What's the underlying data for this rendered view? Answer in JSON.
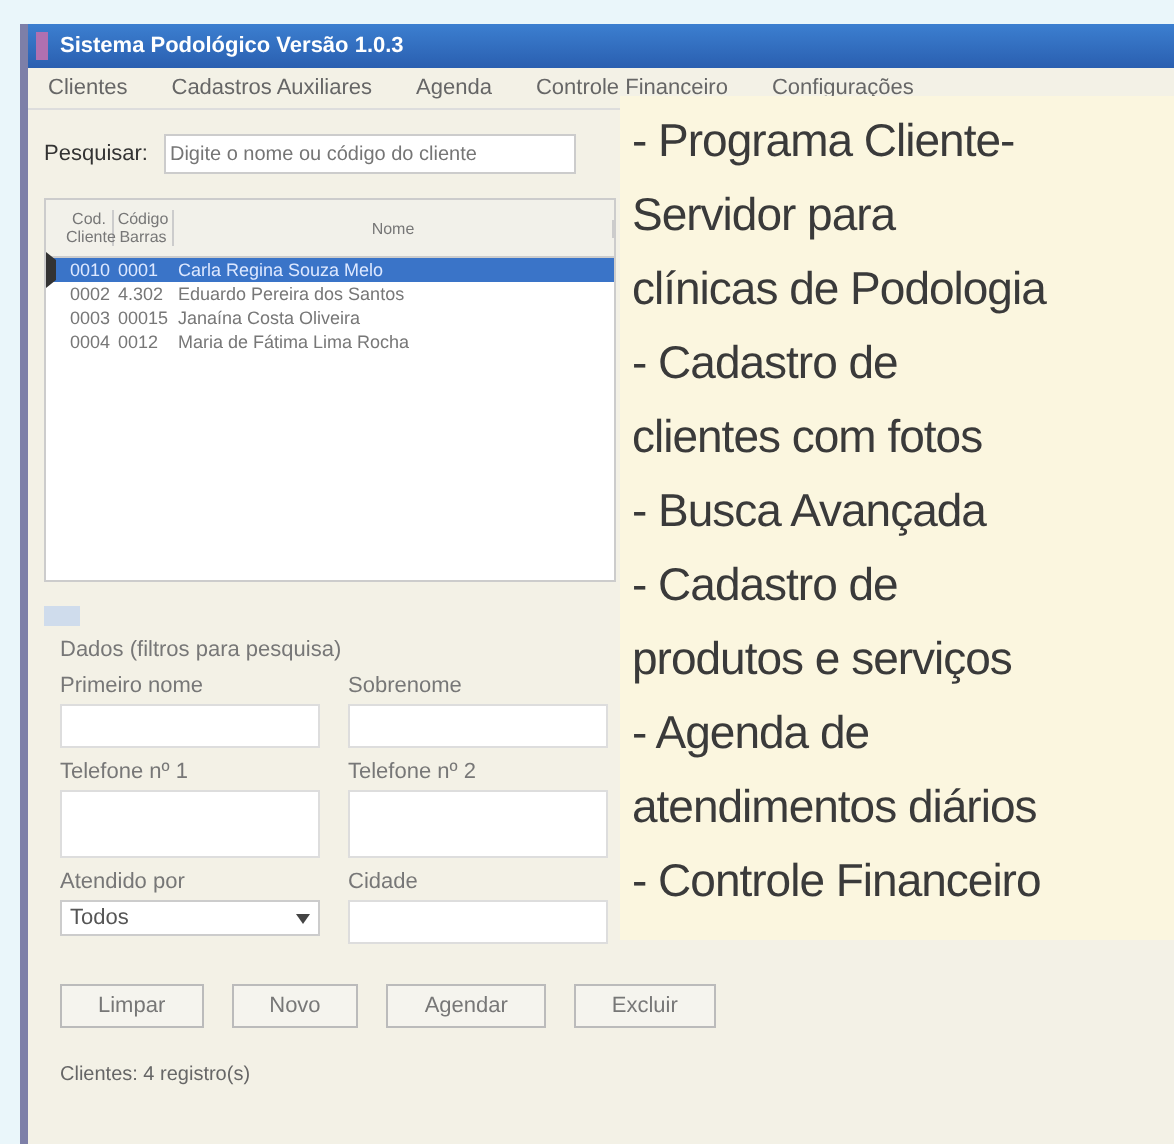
{
  "window": {
    "title": "Sistema Podológico Versão 1.0.3"
  },
  "menu": [
    "Clientes",
    "Cadastros Auxiliares",
    "Agenda",
    "Controle Financeiro",
    "Configurações"
  ],
  "search": {
    "label": "Pesquisar:",
    "placeholder": "Digite o nome ou código do cliente"
  },
  "table": {
    "columns": [
      "Cod. Cliente",
      "Código Barras",
      "Nome"
    ],
    "rows": [
      {
        "selected": true,
        "cells": [
          "0010",
          "0001",
          "Carla Regina Souza Melo"
        ]
      },
      {
        "selected": false,
        "cells": [
          "0002",
          "4.302",
          "Eduardo Pereira dos Santos"
        ]
      },
      {
        "selected": false,
        "cells": [
          "0003",
          "00015",
          "Janaína Costa Oliveira"
        ]
      },
      {
        "selected": false,
        "cells": [
          "0004",
          "0012",
          "Maria de Fátima Lima Rocha"
        ]
      }
    ]
  },
  "filters": {
    "expanded": true,
    "title": "Dados (filtros para pesquisa)",
    "fields": [
      {
        "kind": "text",
        "label": "Primeiro nome"
      },
      {
        "kind": "text",
        "label": "Sobrenome"
      },
      {
        "kind": "tall",
        "label": "Telefone nº 1"
      },
      {
        "kind": "tall",
        "label": "Telefone nº 2"
      },
      {
        "kind": "select",
        "label": "Atendido por",
        "value": "Todos"
      },
      {
        "kind": "text",
        "label": "Cidade"
      }
    ]
  },
  "buttons": [
    "Limpar",
    "Novo",
    "Agendar",
    "Excluir"
  ],
  "status_bar": "Clientes: 4 registro(s)",
  "note": {
    "lines": [
      "- Programa Cliente-",
      "Servidor para",
      "clínicas de Podologia",
      "- Cadastro de",
      "clientes com fotos",
      "- Busca Avançada",
      "- Cadastro de",
      "produtos e serviços",
      "- Agenda de",
      "atendimentos diários",
      "- Controle Financeiro"
    ]
  }
}
